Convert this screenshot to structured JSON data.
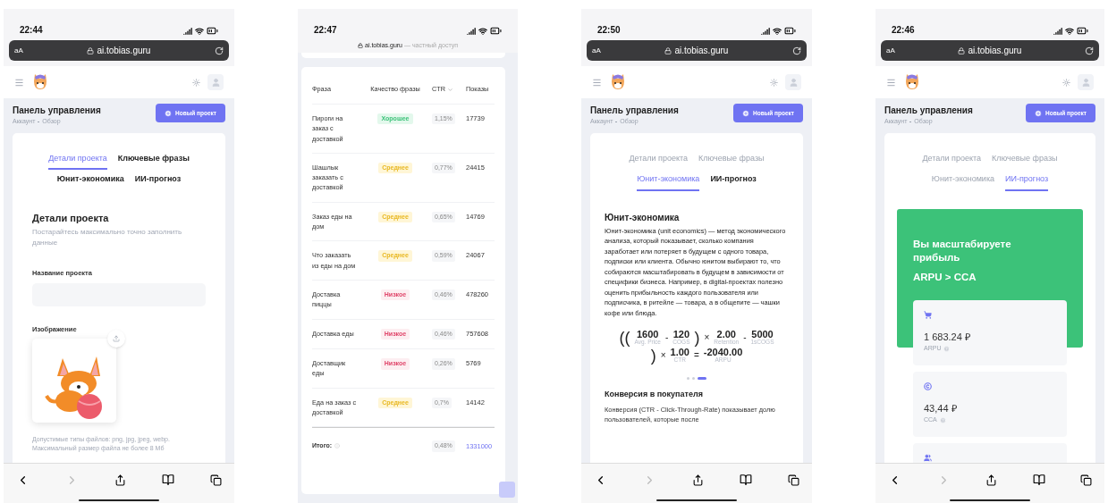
{
  "phones": [
    {
      "kind": "project_details",
      "time": "22:44",
      "address_bar": {
        "text_size": "aA",
        "url": "ai.tobias.guru"
      },
      "header": {
        "title": "Панель управления",
        "breadcrumb": [
          "Аккаунт",
          "Обзор"
        ],
        "new_button": "Новый проект"
      },
      "tabs": [
        {
          "label": "Детали проекта",
          "selected": true,
          "dimmed": false
        },
        {
          "label": "Ключевые фразы",
          "selected": false,
          "dimmed": false
        },
        {
          "label": "Юнит-экономика",
          "selected": false,
          "dimmed": false
        },
        {
          "label": "ИИ-прогноз",
          "selected": false,
          "dimmed": false
        }
      ],
      "details": {
        "title": "Детали проекта",
        "hint": "Постарайтесь максимально точно заполнить данные",
        "name_label": "Название проекта",
        "image_label": "Изображение",
        "file_note": "Допустимые типы файлов: png, jpg, jpeg, webp. Максимальный размер файла не более 8 Мб"
      }
    },
    {
      "kind": "keywords",
      "time": "22:47",
      "address_bar": {
        "url": "ai.tobias.guru",
        "note": "— частный доступ"
      },
      "table": {
        "columns": [
          {
            "label": "Фраза",
            "sorted": false
          },
          {
            "label": "Качество фразы",
            "sorted": false
          },
          {
            "label": "CTR",
            "sorted": true
          },
          {
            "label": "Показы",
            "sorted": false
          }
        ],
        "rows": [
          {
            "phrase": "Пироги на заказ с доставкой",
            "quality": "Хорошее",
            "kind": "good",
            "ctr": "1,15%",
            "shows": "17739"
          },
          {
            "phrase": "Шашлык заказать с доставкой",
            "quality": "Среднее",
            "kind": "medium",
            "ctr": "0,77%",
            "shows": "24415"
          },
          {
            "phrase": "Заказ еды на дом",
            "quality": "Среднее",
            "kind": "medium",
            "ctr": "0,65%",
            "shows": "14769"
          },
          {
            "phrase": "Что заказать из еды на дом",
            "quality": "Среднее",
            "kind": "medium",
            "ctr": "0,59%",
            "shows": "24067"
          },
          {
            "phrase": "Доставка пиццы",
            "quality": "Низкое",
            "kind": "low",
            "ctr": "0,46%",
            "shows": "478260"
          },
          {
            "phrase": "Доставка еды",
            "quality": "Низкое",
            "kind": "low",
            "ctr": "0,46%",
            "shows": "757608"
          },
          {
            "phrase": "Доставщик еды",
            "quality": "Низкое",
            "kind": "low",
            "ctr": "0,26%",
            "shows": "5769"
          },
          {
            "phrase": "Еда на заказ с доставкой",
            "quality": "Среднее",
            "kind": "medium",
            "ctr": "0,7%",
            "shows": "14142"
          }
        ],
        "total": {
          "label": "Итого:",
          "ctr": "0,48%",
          "shows": "1331000"
        }
      }
    },
    {
      "kind": "unit_economics",
      "time": "22:50",
      "address_bar": {
        "text_size": "aA",
        "url": "ai.tobias.guru"
      },
      "header": {
        "title": "Панель управления",
        "breadcrumb": [
          "Аккаунт",
          "Обзор"
        ],
        "new_button": "Новый проект"
      },
      "tabs": [
        {
          "label": "Детали проекта",
          "selected": false,
          "dimmed": true
        },
        {
          "label": "Ключевые фразы",
          "selected": false,
          "dimmed": true
        },
        {
          "label": "Юнит-экономика",
          "selected": true,
          "dimmed": false
        },
        {
          "label": "ИИ-прогноз",
          "selected": false,
          "dimmed": false
        }
      ],
      "unit": {
        "title": "Юнит-экономика",
        "text": "Юнит-экономика (unit economics) — метод экономического анализа, который показывает, сколько компания заработает или потеряет в будущем с одного товара, подписки или клиента. Обычно юнитом выбирают то, что собираются масштабировать в будущем в зависимости от специфики бизнеса. Например, в digital-проектах полезно оценить прибыльность каждого пользователя или подписчика, в ритейле — товара, а в общепите — чашки кофе или блюда.",
        "formula": [
          {
            "kind": "sign",
            "text": "(("
          },
          {
            "kind": "value",
            "value": "1600",
            "label": "Avg. Price"
          },
          {
            "kind": "sign",
            "text": "-"
          },
          {
            "kind": "value",
            "value": "120",
            "label": "COGS"
          },
          {
            "kind": "sign",
            "text": ")"
          },
          {
            "kind": "sign",
            "text": "×"
          },
          {
            "kind": "value",
            "value": "2.00",
            "label": "Retention"
          },
          {
            "kind": "sign",
            "text": "-"
          },
          {
            "kind": "value",
            "value": "5000",
            "label": "1sCOGS"
          },
          {
            "kind": "break"
          },
          {
            "kind": "sign",
            "text": ")"
          },
          {
            "kind": "sign",
            "text": "×"
          },
          {
            "kind": "value",
            "value": "1.00",
            "label": "CTR"
          },
          {
            "kind": "sign",
            "text": "="
          },
          {
            "kind": "value",
            "value": "-2040.00",
            "label": "ARPU"
          }
        ],
        "dots": [
          {
            "selected": false
          },
          {
            "selected": false
          },
          {
            "selected": true
          }
        ],
        "next_title": "Конверсия в покупателя",
        "next_text": "Конверсия (CTR - Click-Through-Rate) показывает долю пользователей, которые после"
      }
    },
    {
      "kind": "forecast",
      "time": "22:46",
      "address_bar": {
        "text_size": "aA",
        "url": "ai.tobias.guru"
      },
      "header": {
        "title": "Панель управления",
        "breadcrumb": [
          "Аккаунт",
          "Обзор"
        ],
        "new_button": "Новый проект"
      },
      "tabs": [
        {
          "label": "Детали проекта",
          "selected": false,
          "dimmed": true
        },
        {
          "label": "Ключевые фразы",
          "selected": false,
          "dimmed": true
        },
        {
          "label": "Юнит-экономика",
          "selected": false,
          "dimmed": true
        },
        {
          "label": "ИИ-прогноз",
          "selected": true,
          "dimmed": false
        }
      ],
      "forecast": {
        "title": "Вы масштабируете прибыль",
        "subtitle": "ARPU > CCA",
        "metrics": [
          {
            "kind": "cart",
            "value": "1 683.24 ₽",
            "label": "ARPU"
          },
          {
            "kind": "coin",
            "value": "43,44 ₽",
            "label": "CCA"
          },
          {
            "kind": "users"
          }
        ]
      }
    }
  ]
}
